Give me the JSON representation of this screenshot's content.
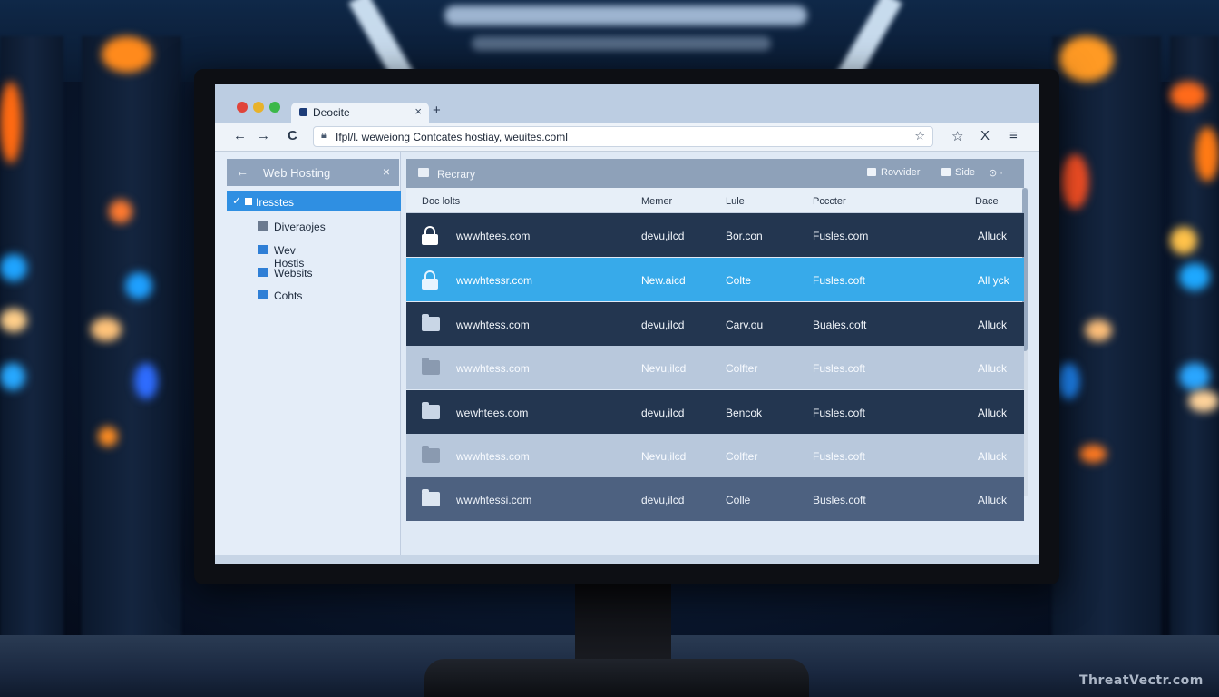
{
  "browser": {
    "tab_title": "Deocite",
    "tab_close": "×",
    "new_tab": "+",
    "url": "Ifpl/l. weweiong Contcates hostiay, weuites.coml",
    "nav_back": "←",
    "nav_forward": "→",
    "nav_reload": "C",
    "bookmark_star": "☆",
    "toolbar_icons": [
      "☆",
      "X",
      "≡"
    ]
  },
  "sidebar": {
    "title": "Web Hosting",
    "back_icon": "←",
    "close_icon": "×",
    "selected_item": "Iresstes",
    "items": [
      {
        "label": "Diveraojes",
        "color": "#6b7a8f"
      },
      {
        "label": "Wev Hostis",
        "color": "#2f7fd6"
      },
      {
        "label": "Websits",
        "color": "#2f7fd6"
      },
      {
        "label": "Cohts",
        "color": "#2f7fd6"
      }
    ]
  },
  "main": {
    "title": "Recrary",
    "actions": {
      "provider": "Rovvider",
      "side": "Side",
      "settings": "⊙ ·"
    },
    "columns": [
      "Doc lolts",
      "Memer",
      "Lule",
      "Pcccter",
      "Dace"
    ],
    "rows": [
      {
        "icon": "lock-icon",
        "style": "dark",
        "domain": "wwwhtees.com",
        "member": "devu,ilcd",
        "rule": "Bor.con",
        "porter": "Fusles.com",
        "date": "Alluck"
      },
      {
        "icon": "lock-icon",
        "style": "sel",
        "domain": "wwwhtessr.com",
        "member": "New.aicd",
        "rule": "Colte",
        "porter": "Fusles.coft",
        "date": "All yck"
      },
      {
        "icon": "folder-icon",
        "style": "dark",
        "domain": "wwwhtess.com",
        "member": "devu,ilcd",
        "rule": "Carv.ou",
        "porter": "Buales.coft",
        "date": "Alluck"
      },
      {
        "icon": "folder-icon",
        "style": "light",
        "domain": "wwwhtess.com",
        "member": "Nevu,ilcd",
        "rule": "Colfter",
        "porter": "Fusles.coft",
        "date": "Alluck"
      },
      {
        "icon": "folder-icon",
        "style": "dark",
        "domain": "wewhtees.com",
        "member": "devu,ilcd",
        "rule": "Bencok",
        "porter": "Fusles.coft",
        "date": "Alluck"
      },
      {
        "icon": "folder-icon",
        "style": "light",
        "domain": "wwwhtess.com",
        "member": "Nevu,ilcd",
        "rule": "Colfter",
        "porter": "Fusles.coft",
        "date": "Alluck"
      },
      {
        "icon": "folder-icon",
        "style": "mid",
        "domain": "wwwhtessi.com",
        "member": "devu,ilcd",
        "rule": "Colle",
        "porter": "Busles.coft",
        "date": "Alluck"
      }
    ]
  },
  "colors": {
    "selected_row": "#37aaea",
    "dark_row": "#233650",
    "accent": "#2f8fe2"
  },
  "watermark": "ThreatVectr.com"
}
